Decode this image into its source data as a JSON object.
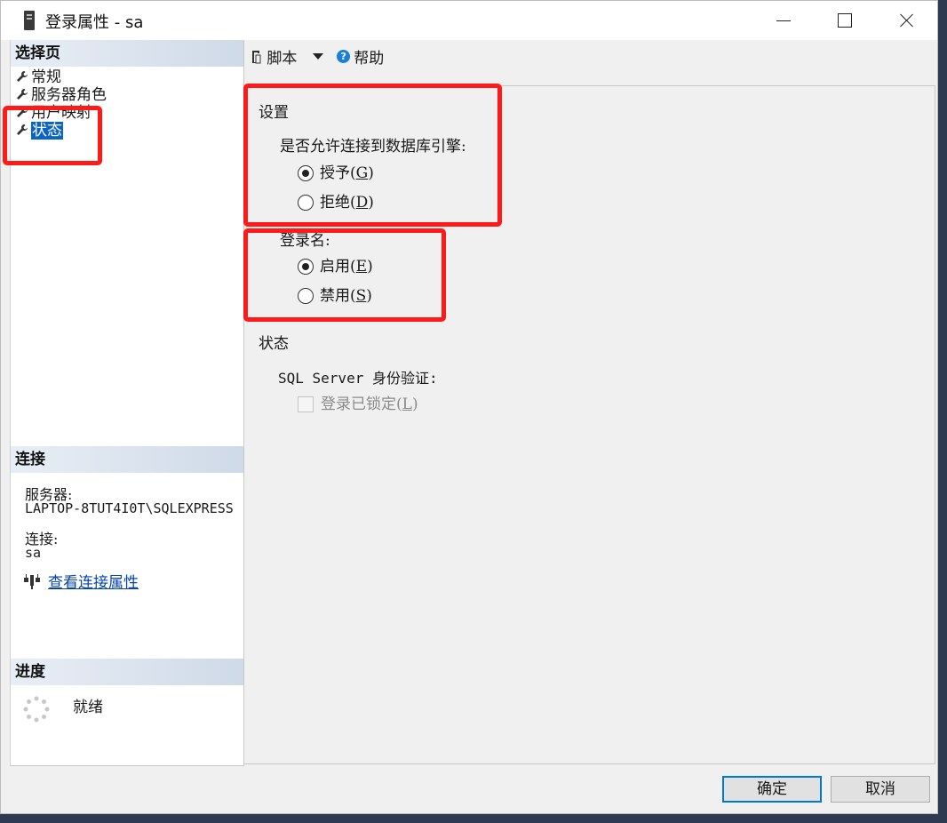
{
  "window": {
    "title": "登录属性 - sa"
  },
  "left": {
    "select_page_header": "选择页",
    "nav_items": [
      {
        "label": "常规"
      },
      {
        "label": "服务器角色"
      },
      {
        "label": "用户映射"
      },
      {
        "label": "状态",
        "selected": true
      }
    ],
    "connection_header": "连接",
    "server_label": "服务器:",
    "server_value": "LAPTOP-8TUT4I0T\\SQLEXPRESS",
    "connection_label": "连接:",
    "connection_value": "sa",
    "view_link": "查看连接属性",
    "progress_header": "进度",
    "progress_status": "就绪"
  },
  "toolbar": {
    "script_label": "脚本",
    "help_label": "帮助"
  },
  "settings": {
    "group_title": "设置",
    "db_engine_question": "是否允许连接到数据库引擎:",
    "grant_label": "授予",
    "grant_key": "G",
    "deny_label": "拒绝",
    "deny_key": "D",
    "grant_selected": true,
    "login_label": "登录名:",
    "enable_label": "启用",
    "enable_key": "E",
    "disable_label": "禁用",
    "disable_key": "S",
    "enable_selected": true
  },
  "status": {
    "group_title": "状态",
    "sql_auth_label": "SQL Server 身份验证:",
    "locked_label": "登录已锁定",
    "locked_key": "L",
    "locked_checked": false
  },
  "buttons": {
    "ok": "确定",
    "cancel": "取消"
  },
  "colors": {
    "highlight": "#ff1a1a",
    "selection": "#0a64c8",
    "link": "#0645ad"
  }
}
